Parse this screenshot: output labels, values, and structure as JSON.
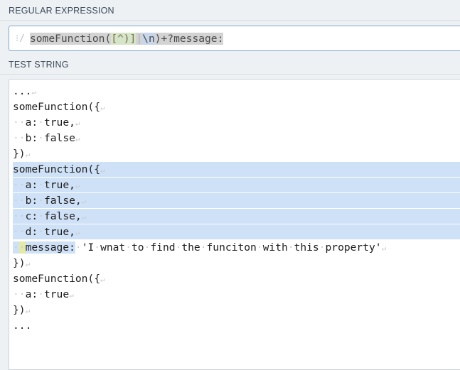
{
  "regex_section": {
    "label": "REGULAR EXPRESSION",
    "delimiter": "/",
    "parts": [
      "someFunction(",
      "[^)]",
      "|",
      "\\n",
      ")+?message:"
    ]
  },
  "test_section": {
    "label": "TEST STRING"
  },
  "test_lines": [
    {
      "indent": 0,
      "text": "...",
      "ret": true,
      "match": false
    },
    {
      "indent": 0,
      "text": "someFunction({",
      "ret": true,
      "match": false
    },
    {
      "indent": 2,
      "text": "a: true,",
      "ret": true,
      "match": false
    },
    {
      "indent": 2,
      "text": "b: false",
      "ret": true,
      "match": false
    },
    {
      "indent": 0,
      "text": "})",
      "ret": true,
      "match": false
    },
    {
      "indent": 0,
      "text": "someFunction({",
      "ret": true,
      "match": true
    },
    {
      "indent": 2,
      "text": "a: true,",
      "ret": true,
      "match": true
    },
    {
      "indent": 2,
      "text": "b: false,",
      "ret": true,
      "match": true
    },
    {
      "indent": 2,
      "text": "c: false,",
      "ret": true,
      "match": true
    },
    {
      "indent": 2,
      "text": "d: true,",
      "ret": true,
      "match": true
    },
    {
      "indent": 2,
      "text": "message:",
      "rest": " 'I wnat to find the funciton with this property'",
      "ret": true,
      "match": "partial"
    },
    {
      "indent": 0,
      "text": "})",
      "ret": true,
      "match": false
    },
    {
      "indent": 0,
      "text": "someFunction({",
      "ret": true,
      "match": false
    },
    {
      "indent": 2,
      "text": "a: true",
      "ret": true,
      "match": false
    },
    {
      "indent": 0,
      "text": "})",
      "ret": true,
      "match": false
    },
    {
      "indent": 0,
      "text": "...",
      "ret": false,
      "match": false
    }
  ],
  "symbols": {
    "space_dot": "·",
    "return": "↵"
  }
}
